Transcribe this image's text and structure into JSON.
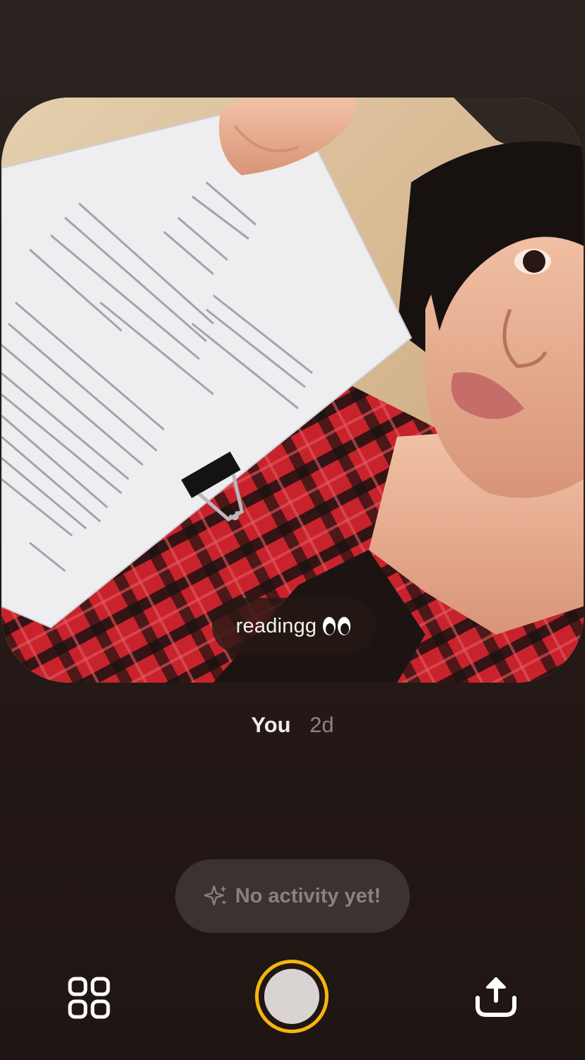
{
  "post": {
    "caption": "readingg",
    "caption_emoji": "eyes-emoji",
    "author": "You",
    "age": "2d"
  },
  "activity": {
    "label": "No activity yet!",
    "icon": "sparkle-icon"
  },
  "toolbar": {
    "left_icon": "grid-icon",
    "center_icon": "shutter",
    "right_icon": "share-icon"
  },
  "colors": {
    "shutter_ring": "#f5b40f",
    "activity_pill_bg": "#3b3331",
    "background_top": "#2b2320",
    "background_bottom": "#1f1513"
  }
}
